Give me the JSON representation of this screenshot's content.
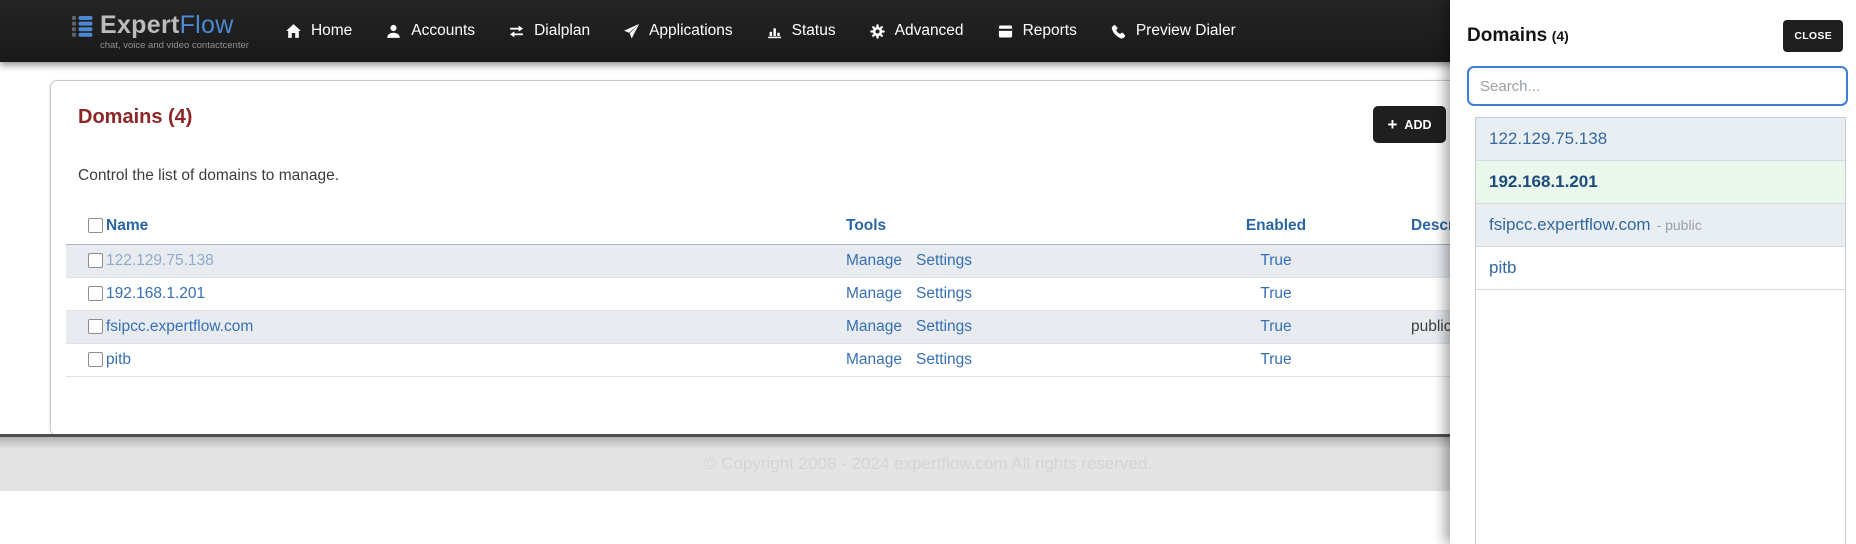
{
  "brand": {
    "name_primary": "Expert",
    "name_secondary": "Flow",
    "tagline": "chat, voice and video contactcenter"
  },
  "nav": {
    "items": [
      {
        "label": "Home",
        "icon": "home-icon"
      },
      {
        "label": "Accounts",
        "icon": "user-icon"
      },
      {
        "label": "Dialplan",
        "icon": "transfer-arrows-icon"
      },
      {
        "label": "Applications",
        "icon": "paper-plane-icon"
      },
      {
        "label": "Status",
        "icon": "bar-chart-icon"
      },
      {
        "label": "Advanced",
        "icon": "gear-icon"
      },
      {
        "label": "Reports",
        "icon": "address-book-icon"
      },
      {
        "label": "Preview Dialer",
        "icon": "phone-icon"
      }
    ]
  },
  "main": {
    "title": "Domains (4)",
    "description": "Control the list of domains to manage.",
    "add_button_label": "ADD",
    "table": {
      "headers": [
        "Name",
        "Tools",
        "Enabled",
        "Description"
      ],
      "rows": [
        {
          "name": "122.129.75.138",
          "muted": true,
          "tools": [
            "Manage",
            "Settings"
          ],
          "enabled": "True",
          "description": ""
        },
        {
          "name": "192.168.1.201",
          "muted": false,
          "tools": [
            "Manage",
            "Settings"
          ],
          "enabled": "True",
          "description": ""
        },
        {
          "name": "fsipcc.expertflow.com",
          "muted": false,
          "tools": [
            "Manage",
            "Settings"
          ],
          "enabled": "True",
          "description": "public"
        },
        {
          "name": "pitb",
          "muted": false,
          "tools": [
            "Manage",
            "Settings"
          ],
          "enabled": "True",
          "description": ""
        }
      ]
    }
  },
  "footer": {
    "copyright": "© Copyright 2008 - 2024 expertflow.com All rights reserved."
  },
  "panel": {
    "title": "Domains",
    "count": "(4)",
    "close_button_label": "CLOSE",
    "search_placeholder": "Search...",
    "search_value": "",
    "items": [
      {
        "label": "122.129.75.138",
        "suffix": "",
        "selected": false
      },
      {
        "label": "192.168.1.201",
        "suffix": "",
        "selected": true
      },
      {
        "label": "fsipcc.expertflow.com",
        "suffix": "- public",
        "selected": false
      },
      {
        "label": "pitb",
        "suffix": "",
        "selected": false
      }
    ]
  },
  "colors": {
    "navbar_bg": "#1d1d1d",
    "brand_blue": "#4d89d2",
    "heading_maroon": "#8d2626",
    "table_header_blue": "#2a66a3",
    "link_blue": "#366fb3",
    "row_stripe": "#e8ecf1",
    "selected_item_green": "#e9f7ec",
    "search_focus_border": "#3d7fd6",
    "dark_button": "#1f1f1f"
  }
}
